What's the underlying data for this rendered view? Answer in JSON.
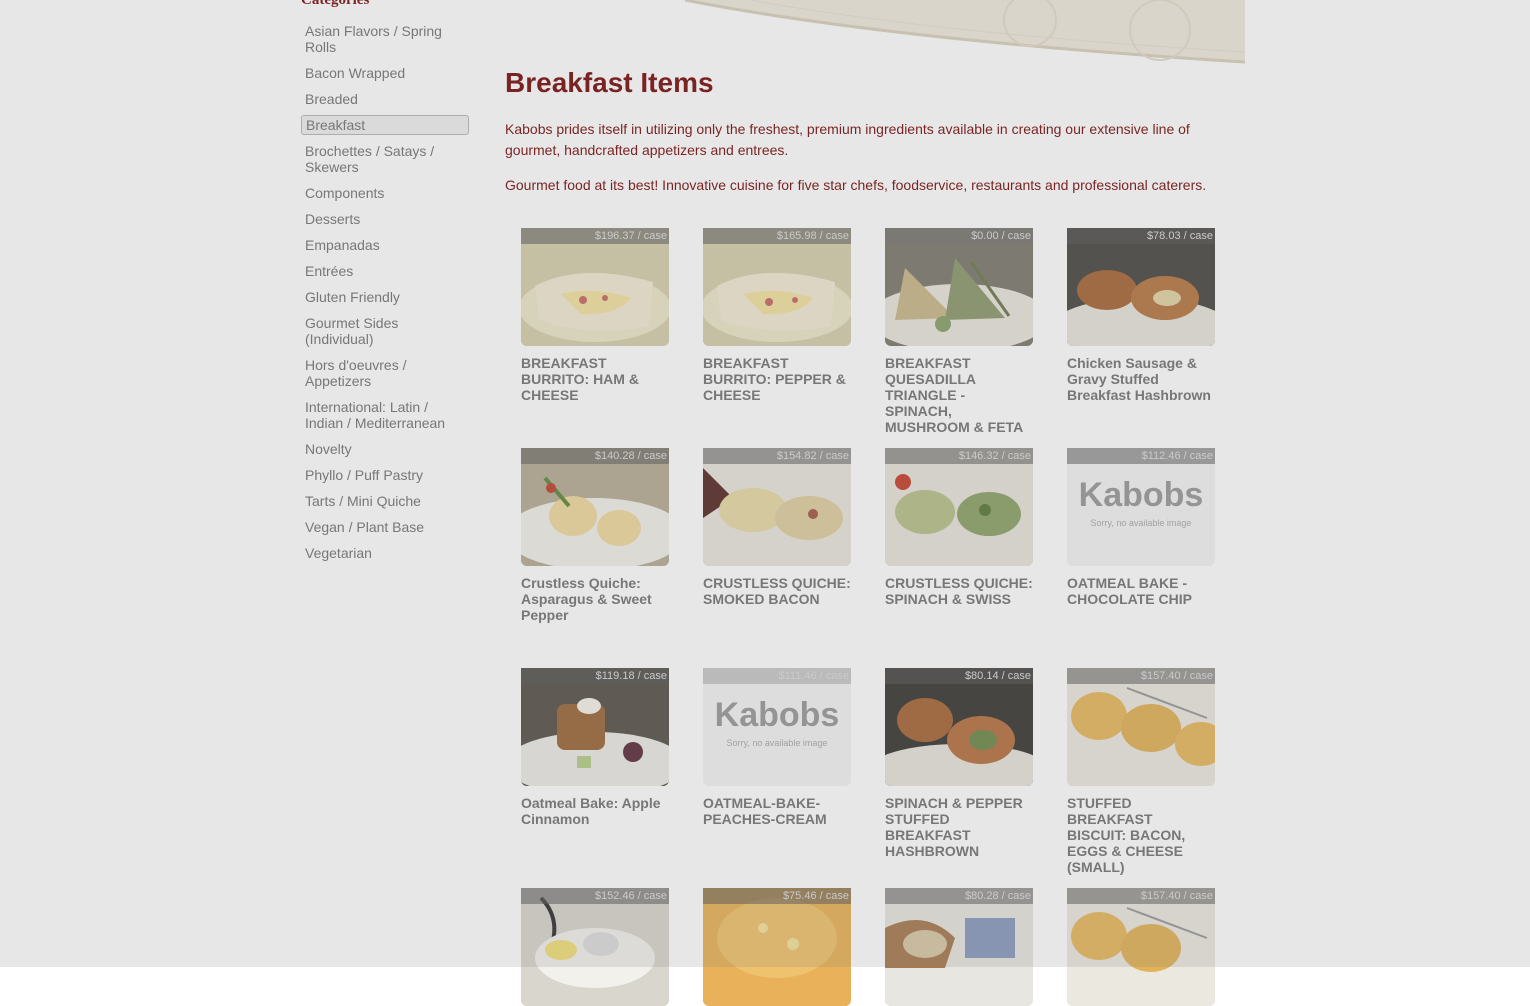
{
  "sidebar": {
    "heading": "Categories",
    "items": [
      {
        "label": "Asian Flavors / Spring Rolls"
      },
      {
        "label": "Bacon Wrapped"
      },
      {
        "label": "Breaded"
      },
      {
        "label": "Breakfast",
        "active": true
      },
      {
        "label": "Brochettes / Satays / Skewers"
      },
      {
        "label": "Components"
      },
      {
        "label": "Desserts"
      },
      {
        "label": "Empanadas"
      },
      {
        "label": "Entrées"
      },
      {
        "label": "Gluten Friendly"
      },
      {
        "label": "Gourmet Sides (Individual)"
      },
      {
        "label": "Hors d'oeuvres / Appetizers"
      },
      {
        "label": "International: Latin / Indian / Mediterranean"
      },
      {
        "label": "Novelty"
      },
      {
        "label": "Phyllo / Puff Pastry"
      },
      {
        "label": "Tarts / Mini Quiche"
      },
      {
        "label": "Vegan / Plant Base"
      },
      {
        "label": "Vegetarian"
      }
    ]
  },
  "main": {
    "title": "Breakfast Items",
    "intro_1": "Kabobs prides itself in utilizing only the freshest, premium ingredients available in creating our extensive line of gourmet, handcrafted appetizers and entrees.",
    "intro_2": "Gourmet food at its best! Innovative cuisine for five star chefs, foodservice, restaurants and professional caterers."
  },
  "placeholder": {
    "logo": "Kabobs",
    "note": "Sorry, no available image"
  },
  "products": [
    {
      "price": "$196.37 / case",
      "name": "BREAKFAST BURRITO: HAM & CHEESE",
      "image": "burrito"
    },
    {
      "price": "$165.98 / case",
      "name": "BREAKFAST BURRITO: PEPPER & CHEESE",
      "image": "burrito"
    },
    {
      "price": "$0.00 / case",
      "name": "BREAKFAST QUESADILLA TRIANGLE - SPINACH, MUSHROOM & FETA",
      "image": "quesadilla"
    },
    {
      "price": "$78.03 / case",
      "name": "Chicken Sausage & Gravy Stuffed Breakfast Hashbrown",
      "image": "hashbrown"
    },
    {
      "price": "$140.28 / case",
      "name": "Crustless Quiche: Asparagus & Sweet Pepper",
      "image": "quiche-asparagus"
    },
    {
      "price": "$154.82 / case",
      "name": "CRUSTLESS QUICHE: SMOKED BACON",
      "image": "quiche-bacon"
    },
    {
      "price": "$146.32 / case",
      "name": "CRUSTLESS QUICHE: SPINACH & SWISS",
      "image": "quiche-spinach"
    },
    {
      "price": "$112.46 / case",
      "name": "OATMEAL BAKE - CHOCOLATE CHIP",
      "image": "placeholder"
    },
    {
      "price": "$119.18 / case",
      "name": "Oatmeal Bake: Apple Cinnamon",
      "image": "oatmeal-apple"
    },
    {
      "price": "$111.46 / case",
      "name": "OATMEAL-BAKE-PEACHES-CREAM",
      "image": "placeholder"
    },
    {
      "price": "$80.14 / case",
      "name": "SPINACH & PEPPER STUFFED BREAKFAST HASHBROWN",
      "image": "hashbrown-spinach"
    },
    {
      "price": "$157.40 / case",
      "name": "STUFFED BREAKFAST BISCUIT: BACON, EGGS & CHEESE (SMALL)",
      "image": "biscuit"
    },
    {
      "price": "$152.46 / case",
      "name": "",
      "image": "plate-lemon"
    },
    {
      "price": "$75.46 / case",
      "name": "",
      "image": "biscuit-single"
    },
    {
      "price": "$80.28 / case",
      "name": "",
      "image": "basket"
    },
    {
      "price": "$157.40 / case",
      "name": "",
      "image": "biscuit"
    }
  ]
}
